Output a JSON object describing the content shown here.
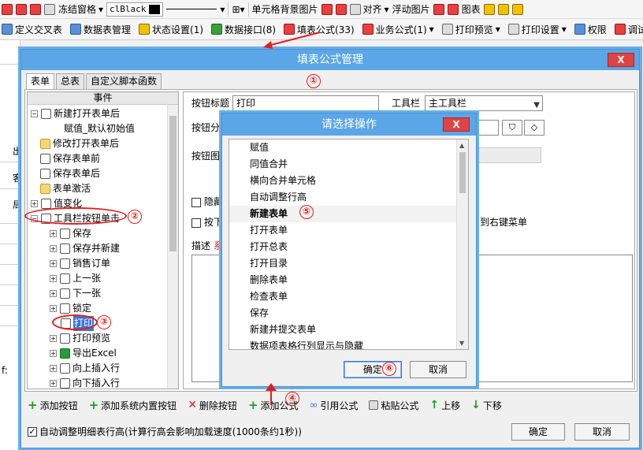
{
  "toolbar1": {
    "freeze_label": "冻结窗格",
    "color_value": "clBlack",
    "bg_image_label": "单元格背景图片",
    "align_label": "对齐",
    "float_image_label": "浮动图片",
    "chart_label": "图表"
  },
  "toolbar2": {
    "items": [
      "定义交叉表",
      "数据表管理",
      "状态设置(1)",
      "数据接口(8)",
      "填表公式(33)",
      "业务公式(1)",
      "打印预览",
      "打印设置",
      "权限",
      "调试"
    ]
  },
  "left_strip_labels": [
    "出",
    "客",
    "局",
    "f:"
  ],
  "dialog": {
    "title": "填表公式管理",
    "close": "X",
    "tabs": [
      "表单",
      "总表",
      "自定义脚本函数"
    ],
    "events_header": "事件",
    "tree": [
      {
        "label": "新建打开表单后"
      },
      {
        "label": "赋值_默认初始值"
      },
      {
        "label": "修改打开表单后"
      },
      {
        "label": "保存表单前"
      },
      {
        "label": "保存表单后"
      },
      {
        "label": "表单激活"
      },
      {
        "label": "值变化"
      },
      {
        "label": "工具栏按钮单击"
      },
      {
        "label": "保存"
      },
      {
        "label": "保存并新建"
      },
      {
        "label": "销售订单"
      },
      {
        "label": "上一张"
      },
      {
        "label": "下一张"
      },
      {
        "label": "锁定"
      },
      {
        "label": "打印"
      },
      {
        "label": "打印预览"
      },
      {
        "label": "导出Excel"
      },
      {
        "label": "向上插入行"
      },
      {
        "label": "向下插入行"
      }
    ],
    "form": {
      "button_title_label": "按钮标题",
      "button_title_value": "打印",
      "toolbar_label": "工具栏",
      "toolbar_value": "主工具栏",
      "button_group_label": "按钮分组",
      "button_image_label": "按钮图片",
      "hide_label": "隐藏",
      "press_label": "按下",
      "right_menu_label": "到右键菜单",
      "desc_label": "描述",
      "desc_red": "系"
    },
    "bottom_buttons": [
      "添加按钮",
      "添加系统内置按钮",
      "删除按钮",
      "添加公式",
      "引用公式",
      "粘贴公式",
      "上移",
      "下移"
    ],
    "auto_adjust_label": "自动调整明细表行高(计算行高会影响加载速度(1000条约1秒))",
    "ok": "确定",
    "cancel": "取消"
  },
  "popup": {
    "title": "请选择操作",
    "close": "X",
    "items": [
      "赋值",
      "同值合并",
      "横向合并单元格",
      "自动调整行高",
      "新建表单",
      "打开表单",
      "打开总表",
      "打开目录",
      "删除表单",
      "检查表单",
      "保存",
      "新建并提交表单",
      "数据项表格行列显示与隐藏"
    ],
    "highlighted_index": 4,
    "ok": "确定",
    "cancel": "取消"
  },
  "annotations": [
    "①",
    "②",
    "③",
    "④",
    "⑤",
    "⑥"
  ]
}
